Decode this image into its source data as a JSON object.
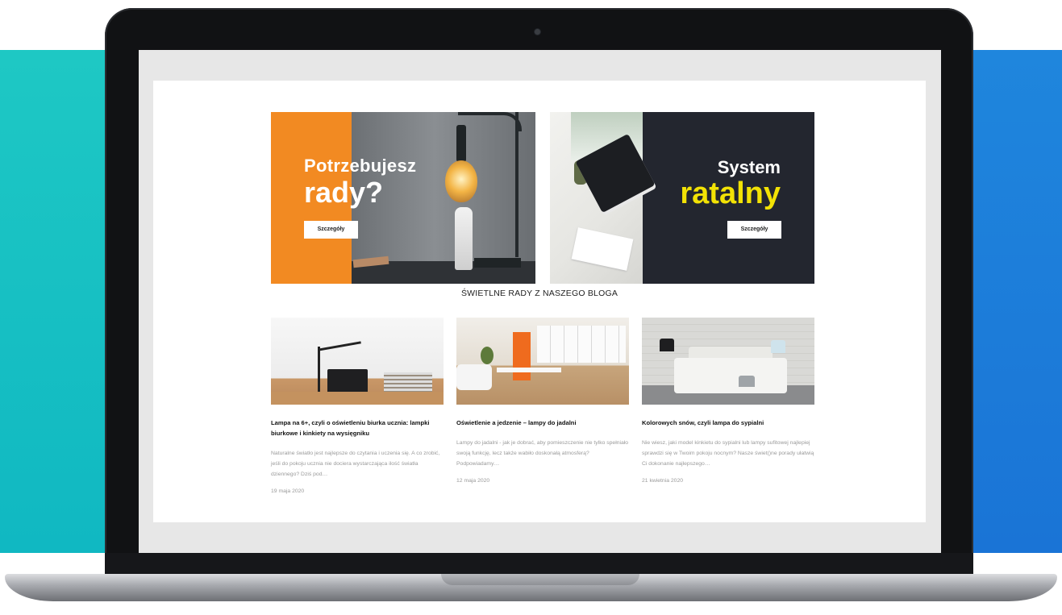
{
  "banners": {
    "advice": {
      "line1": "Potrzebujesz",
      "line2": "rady?",
      "button": "Szczegóły"
    },
    "installment": {
      "line1": "System",
      "line2": "ratalny",
      "button": "Szczegóły"
    }
  },
  "blog": {
    "heading": "ŚWIETLNE RADY Z NASZEGO BLOGA",
    "posts": [
      {
        "title": "Lampa na 6+, czyli o oświetleniu biurka ucznia: lampki biurkowe i kinkiety na wysięgniku",
        "excerpt": "Naturalne światło jest najlepsze do czytania i uczenia się. A co zrobić, jeśli do pokoju ucznia nie dociera wystarczająca ilość światła dziennego? Dziś pod…",
        "date": "19 maja 2020"
      },
      {
        "title": "Oświetlenie a jedzenie – lampy do jadalni",
        "excerpt": "Lampy do jadalni - jak je dobrać, aby pomieszczenie nie tylko spełniało swoją funkcję, lecz także wabiło doskonałą atmosferą? Podpowiadamy…",
        "date": "12 maja 2020"
      },
      {
        "title": "Kolorowych snów, czyli lampa do sypialni",
        "excerpt": "Nie wiesz, jaki model kinkietu do sypialni lub lampy sufitowej najlepiej sprawdzi się w Twoim pokoju nocnym? Nasze świet()ne porady ułatwią Ci dokonanie najlepszego…",
        "date": "21 kwietnia 2020"
      }
    ]
  },
  "colors": {
    "orange_accent": "#f28a22",
    "yellow_accent": "#f2e205",
    "dark_panel": "#23262f",
    "teal_background": "#1ec8c4",
    "blue_background": "#1f86dd"
  }
}
